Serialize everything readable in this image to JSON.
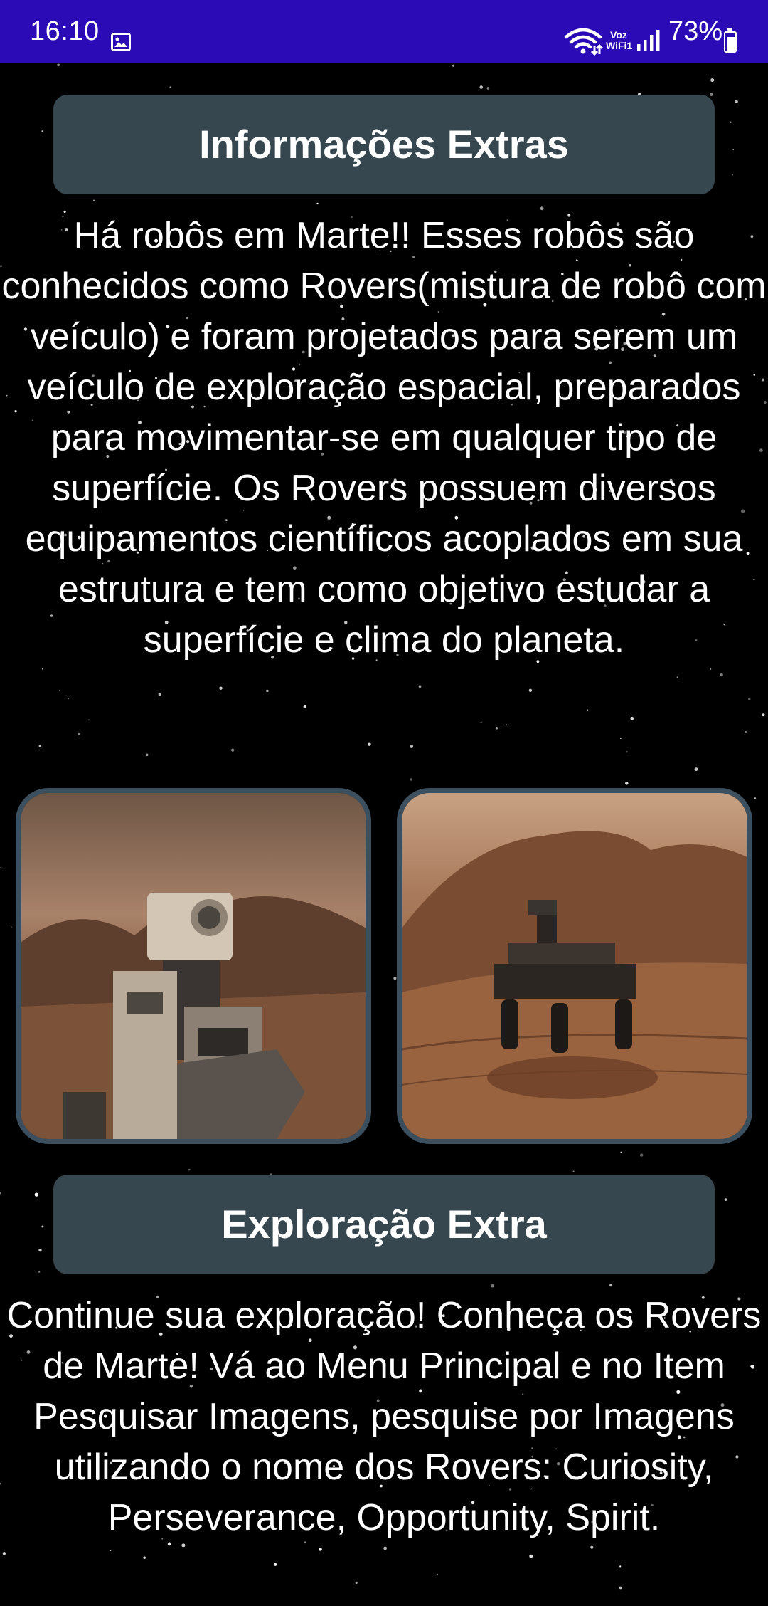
{
  "status_bar": {
    "time": "16:10",
    "gallery_icon": "image-icon",
    "wifi_icon": "wifi-icon",
    "voz_label": "Voz WiFi1",
    "signal_icon": "cellular-signal-icon",
    "battery_percent": "73%",
    "battery_icon": "battery-charging-icon",
    "background_color": "#2a0bb5"
  },
  "sections": {
    "info": {
      "title": "Informações Extras",
      "text": "Há robôs em Marte!! Esses robôs são conhecidos como Rovers(mistura de robô com veículo) e foram projetados para serem um veículo de exploração espacial, preparados para movimentar-se em qualquer tipo de superfície. Os Rovers possuem diversos equipamentos científicos acoplados em sua estrutura e tem como objetivo estudar a superfície e clima do planeta."
    },
    "explore": {
      "title": "Exploração Extra",
      "text": "Continue sua exploração! Conheça os Rovers de Marte! Vá ao Menu Principal e no Item Pesquisar Imagens, pesquise por Imagens utilizando o nome dos Rovers: Curiosity, Perseverance, Opportunity, Spirit."
    }
  },
  "images": {
    "left": "rover-selfie-image",
    "right": "rover-driving-image"
  },
  "colors": {
    "button_background": "#37474f",
    "image_border": "#3b4f5e",
    "page_background": "#000000",
    "text": "#ffffff"
  }
}
